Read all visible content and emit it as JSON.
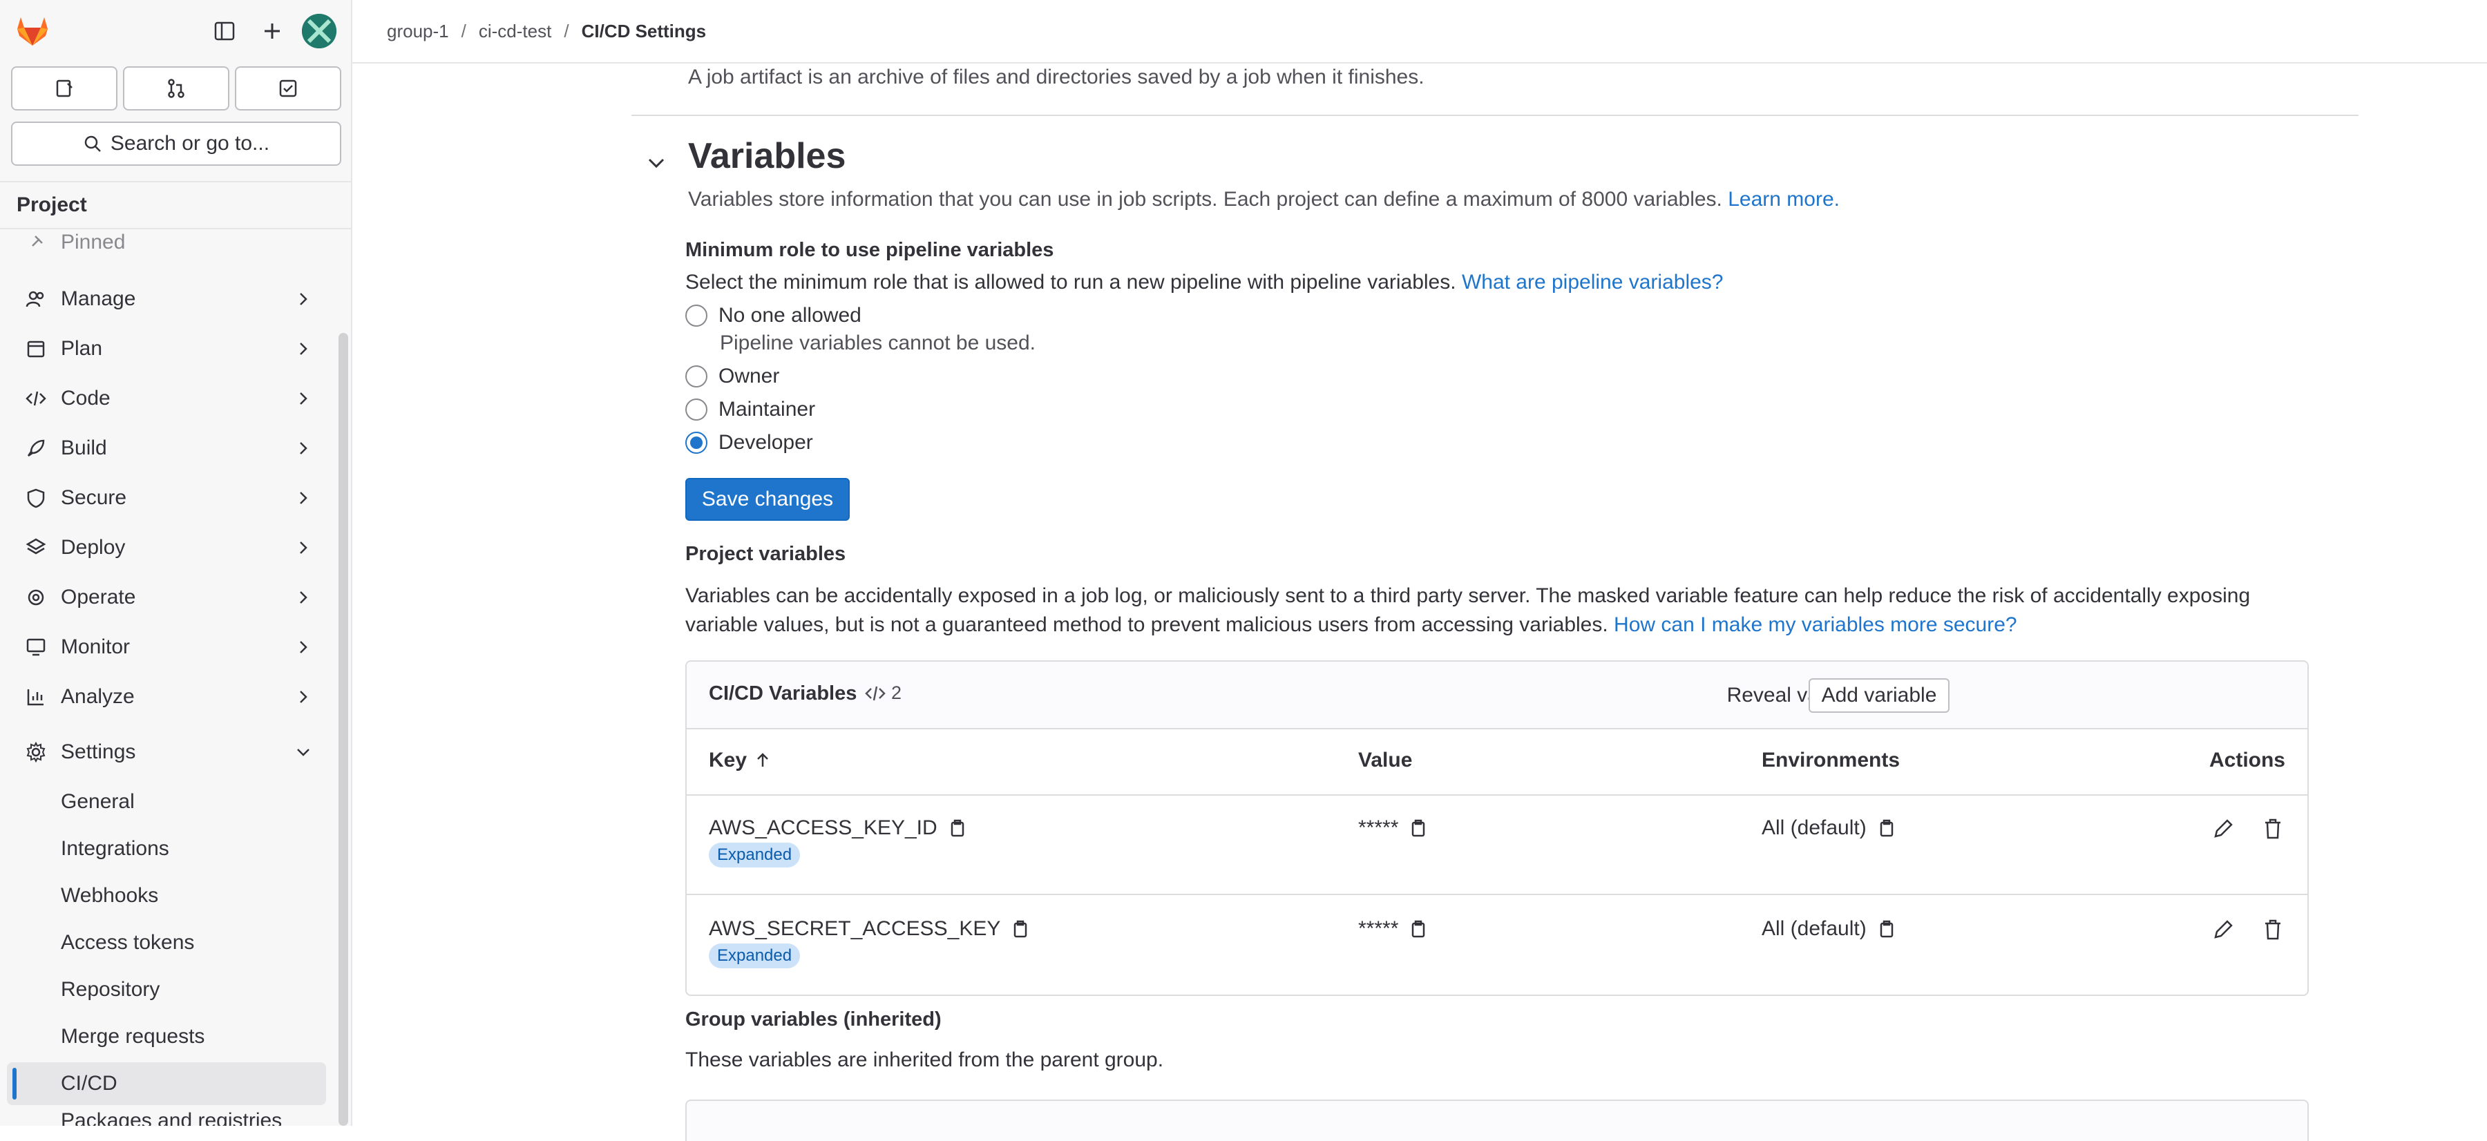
{
  "breadcrumb": {
    "group": "group-1",
    "project": "ci-cd-test",
    "current": "CI/CD Settings",
    "sep": "/"
  },
  "sidebar": {
    "search_label": "Search or go to...",
    "context": "Project",
    "pinned": "Pinned",
    "items": [
      {
        "label": "Manage"
      },
      {
        "label": "Plan"
      },
      {
        "label": "Code"
      },
      {
        "label": "Build"
      },
      {
        "label": "Secure"
      },
      {
        "label": "Deploy"
      },
      {
        "label": "Operate"
      },
      {
        "label": "Monitor"
      },
      {
        "label": "Analyze"
      },
      {
        "label": "Settings"
      }
    ],
    "settings_sub": [
      {
        "label": "General"
      },
      {
        "label": "Integrations"
      },
      {
        "label": "Webhooks"
      },
      {
        "label": "Access tokens"
      },
      {
        "label": "Repository"
      },
      {
        "label": "Merge requests"
      },
      {
        "label": "CI/CD"
      },
      {
        "label": "Packages and registries"
      }
    ]
  },
  "artifacts": {
    "description": "A job artifact is an archive of files and directories saved by a job when it finishes."
  },
  "variables": {
    "title": "Variables",
    "description": "Variables store information that you can use in job scripts. Each project can define a maximum of 8000 variables.",
    "learn_more": "Learn more.",
    "min_role_label": "Minimum role to use pipeline variables",
    "min_role_desc": "Select the minimum role that is allowed to run a new pipeline with pipeline variables.",
    "min_role_link": "What are pipeline variables?",
    "options": [
      {
        "label": "No one allowed",
        "help": "Pipeline variables cannot be used.",
        "checked": false
      },
      {
        "label": "Owner",
        "checked": false
      },
      {
        "label": "Maintainer",
        "checked": false
      },
      {
        "label": "Developer",
        "checked": true
      }
    ],
    "save_button": "Save changes",
    "project_vars_label": "Project variables",
    "project_vars_desc_1": "Variables can be accidentally exposed in a job log, or maliciously sent to a third party server. The masked variable feature can help reduce the risk of accidentally exposing",
    "project_vars_desc_2": "variable values, but is not a guaranteed method to prevent malicious users from accessing variables.",
    "project_vars_link": "How can I make my variables more secure?",
    "table": {
      "title": "CI/CD Variables",
      "count": "2",
      "reveal_button": "Reveal values",
      "add_button": "Add variable",
      "columns": {
        "key": "Key",
        "value": "Value",
        "environments": "Environments",
        "actions": "Actions"
      },
      "rows": [
        {
          "key": "AWS_ACCESS_KEY_ID",
          "badge": "Expanded",
          "value": "*****",
          "environment": "All (default)"
        },
        {
          "key": "AWS_SECRET_ACCESS_KEY",
          "badge": "Expanded",
          "value": "*****",
          "environment": "All (default)"
        }
      ]
    },
    "group_vars_label": "Group variables (inherited)",
    "group_vars_desc": "These variables are inherited from the parent group."
  },
  "colors": {
    "accent": "#1f75cb",
    "badge_bg": "#cbe2f9",
    "badge_text": "#0b5cad"
  }
}
